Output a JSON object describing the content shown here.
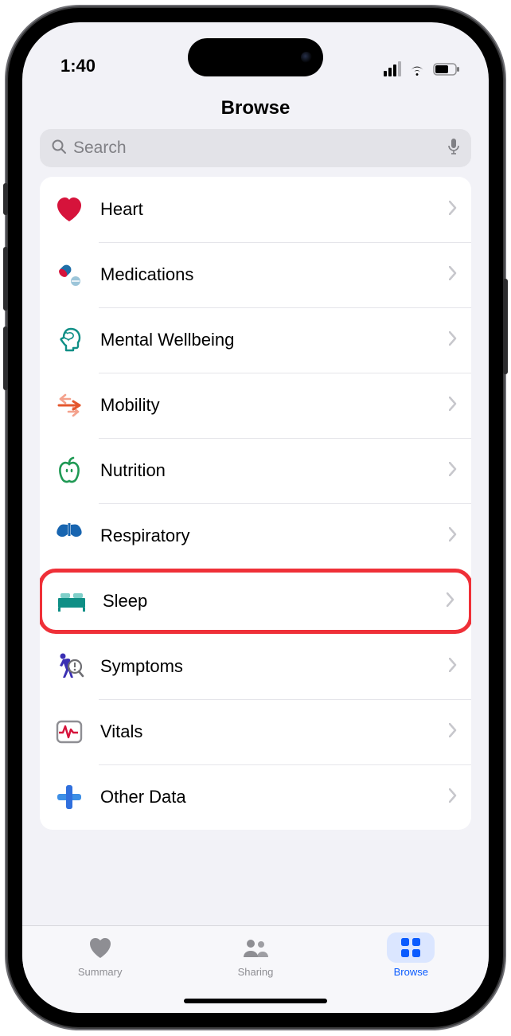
{
  "status": {
    "time": "1:40"
  },
  "header": {
    "title": "Browse"
  },
  "search": {
    "placeholder": "Search"
  },
  "categories": [
    {
      "label": "Heart"
    },
    {
      "label": "Medications"
    },
    {
      "label": "Mental Wellbeing"
    },
    {
      "label": "Mobility"
    },
    {
      "label": "Nutrition"
    },
    {
      "label": "Respiratory"
    },
    {
      "label": "Sleep"
    },
    {
      "label": "Symptoms"
    },
    {
      "label": "Vitals"
    },
    {
      "label": "Other Data"
    }
  ],
  "tabs": [
    {
      "label": "Summary"
    },
    {
      "label": "Sharing"
    },
    {
      "label": "Browse"
    }
  ]
}
